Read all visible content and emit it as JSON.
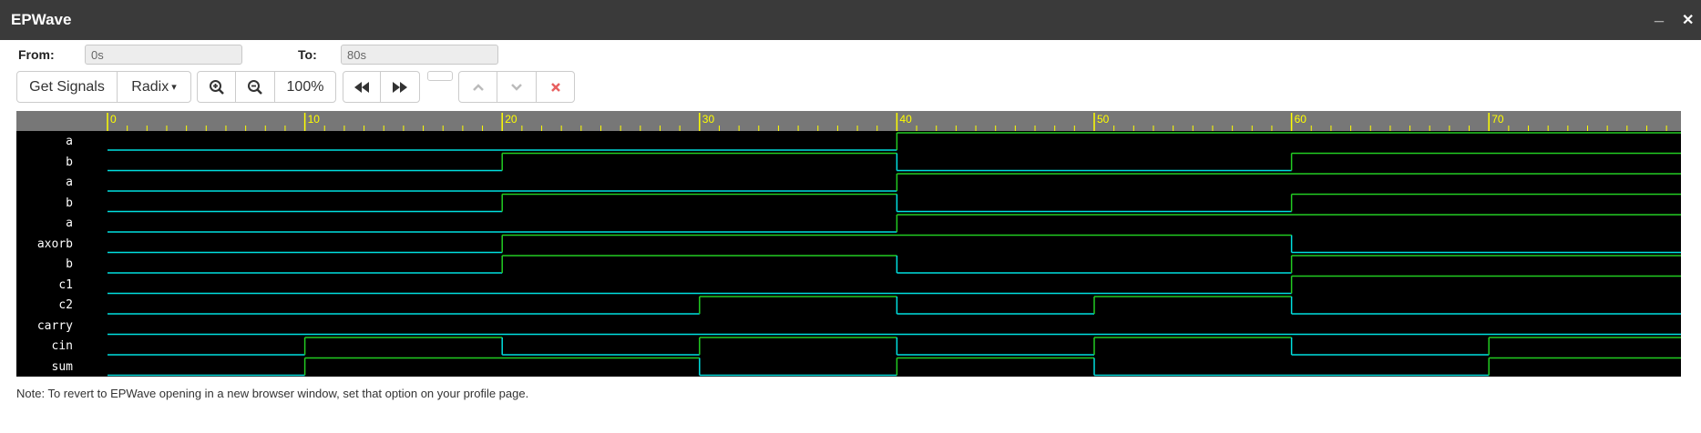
{
  "window": {
    "title": "EPWave",
    "minimize_glyph": "_",
    "close_glyph": "✕"
  },
  "range": {
    "from_label": "From:",
    "from_value": "0s",
    "to_label": "To:",
    "to_value": "80s"
  },
  "toolbar": {
    "get_signals": "Get Signals",
    "radix": "Radix",
    "radix_caret": "▾",
    "zoom_in_icon": "zoom-in-icon",
    "zoom_out_icon": "zoom-out-icon",
    "zoom_level": "100%",
    "prev_icon": "rewind-icon",
    "next_icon": "fast-forward-icon",
    "up_icon": "chevron-up-icon",
    "down_icon": "chevron-down-icon",
    "delete_icon": "close-icon"
  },
  "waveform": {
    "time_range": [
      0,
      80
    ],
    "tick_labels": [
      "0",
      "10",
      "20",
      "30",
      "40",
      "50",
      "60",
      "70"
    ],
    "colors": {
      "background": "#000000",
      "ruler": "#777777",
      "tick": "#ffff00",
      "low": "#00e0e0",
      "high": "#22cc22",
      "label": "#ffffff"
    },
    "signals": [
      {
        "name": "a",
        "transitions": [
          [
            0,
            0
          ],
          [
            40,
            1
          ]
        ]
      },
      {
        "name": "b",
        "transitions": [
          [
            0,
            0
          ],
          [
            20,
            1
          ],
          [
            40,
            0
          ],
          [
            60,
            1
          ]
        ]
      },
      {
        "name": "a",
        "transitions": [
          [
            0,
            0
          ],
          [
            40,
            1
          ]
        ]
      },
      {
        "name": "b",
        "transitions": [
          [
            0,
            0
          ],
          [
            20,
            1
          ],
          [
            40,
            0
          ],
          [
            60,
            1
          ]
        ]
      },
      {
        "name": "a",
        "transitions": [
          [
            0,
            0
          ],
          [
            40,
            1
          ]
        ]
      },
      {
        "name": "axorb",
        "transitions": [
          [
            0,
            0
          ],
          [
            20,
            1
          ],
          [
            60,
            0
          ]
        ]
      },
      {
        "name": "b",
        "transitions": [
          [
            0,
            0
          ],
          [
            20,
            1
          ],
          [
            40,
            0
          ],
          [
            60,
            1
          ]
        ]
      },
      {
        "name": "c1",
        "transitions": [
          [
            0,
            0
          ],
          [
            60,
            1
          ]
        ]
      },
      {
        "name": "c2",
        "transitions": [
          [
            0,
            0
          ],
          [
            30,
            1
          ],
          [
            40,
            0
          ],
          [
            50,
            1
          ],
          [
            60,
            0
          ]
        ]
      },
      {
        "name": "carry",
        "transitions": [
          [
            0,
            0
          ]
        ]
      },
      {
        "name": "cin",
        "transitions": [
          [
            0,
            0
          ],
          [
            10,
            1
          ],
          [
            20,
            0
          ],
          [
            30,
            1
          ],
          [
            40,
            0
          ],
          [
            50,
            1
          ],
          [
            60,
            0
          ],
          [
            70,
            1
          ]
        ]
      },
      {
        "name": "sum",
        "transitions": [
          [
            0,
            0
          ],
          [
            10,
            1
          ],
          [
            30,
            0
          ],
          [
            40,
            1
          ],
          [
            50,
            0
          ],
          [
            70,
            1
          ]
        ]
      }
    ]
  },
  "note": "Note: To revert to EPWave opening in a new browser window, set that option on your profile page."
}
